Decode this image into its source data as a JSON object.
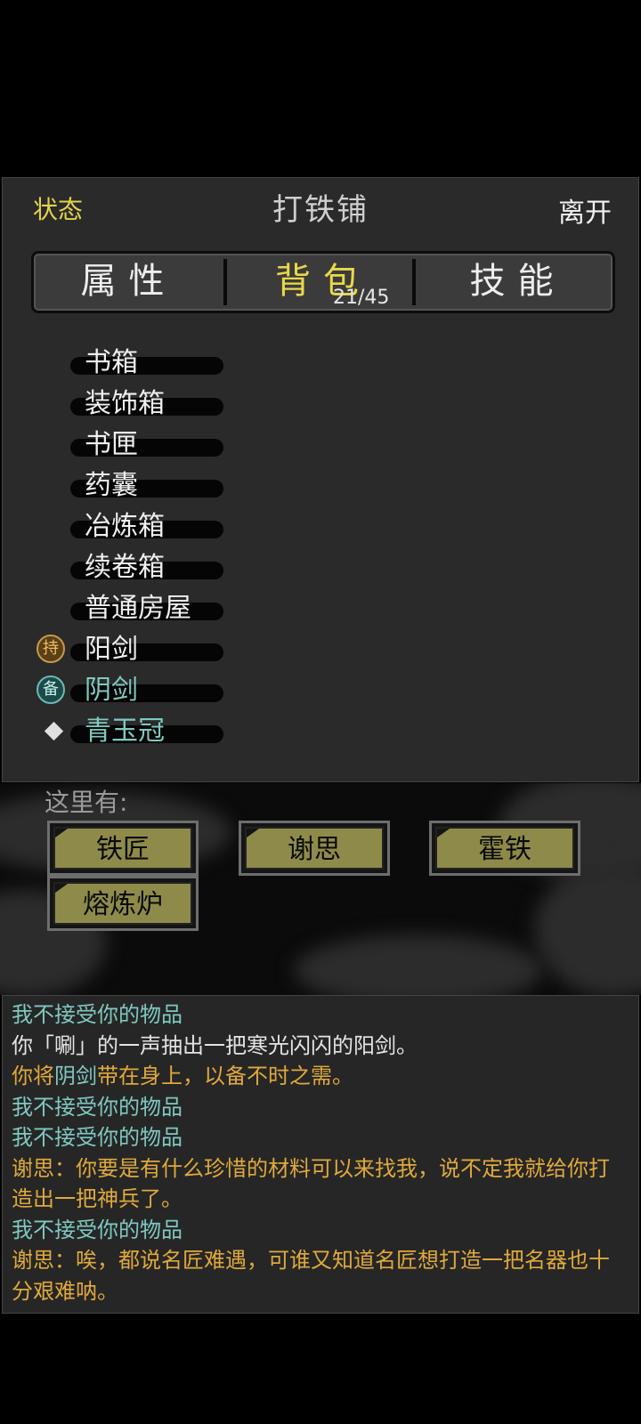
{
  "header": {
    "left_label": "状态",
    "title": "打铁铺",
    "right_label": "离开"
  },
  "tabs": [
    {
      "label": "属性"
    },
    {
      "label": "背包",
      "count": "21/45"
    },
    {
      "label": "技能"
    }
  ],
  "items": [
    {
      "label": "书箱",
      "tag": ""
    },
    {
      "label": "装饰箱",
      "tag": ""
    },
    {
      "label": "书匣",
      "tag": ""
    },
    {
      "label": "药囊",
      "tag": ""
    },
    {
      "label": "冶炼箱",
      "tag": ""
    },
    {
      "label": "续卷箱",
      "tag": ""
    },
    {
      "label": "普通房屋",
      "tag": ""
    },
    {
      "label": "阳剑",
      "tag": "持"
    },
    {
      "label": "阴剑",
      "tag": "备"
    },
    {
      "label": "青玉冠",
      "tag": ""
    }
  ],
  "scene": {
    "here_label": "这里有:",
    "npcs": [
      "铁匠",
      "谢思",
      "霍铁",
      "熔炼炉"
    ]
  },
  "log": [
    {
      "text": "我不接受你的物品",
      "color": "teal"
    },
    {
      "text": "你「唰」的一声抽出一把寒光闪闪的阳剑。",
      "color": "white"
    },
    {
      "prefix": "你将",
      "highlight": "阴剑",
      "suffix": "带在身上，以备不时之需。",
      "color": "gold"
    },
    {
      "text": "我不接受你的物品",
      "color": "teal"
    },
    {
      "text": "我不接受你的物品",
      "color": "teal"
    },
    {
      "text": "谢思：你要是有什么珍惜的材料可以来找我，说不定我就给你打造出一把神兵了。",
      "color": "gold"
    },
    {
      "text": "我不接受你的物品",
      "color": "teal"
    },
    {
      "text": "谢思：唉，都说名匠难遇，可谁又知道名匠想打造一把名器也十分艰难呐。",
      "color": "gold"
    }
  ],
  "colors": {
    "accent_yellow": "#e2d24e",
    "teal_text": "#7fc9c0",
    "gold_text": "#e0a93c",
    "npc_button": "#8e8b4a"
  }
}
